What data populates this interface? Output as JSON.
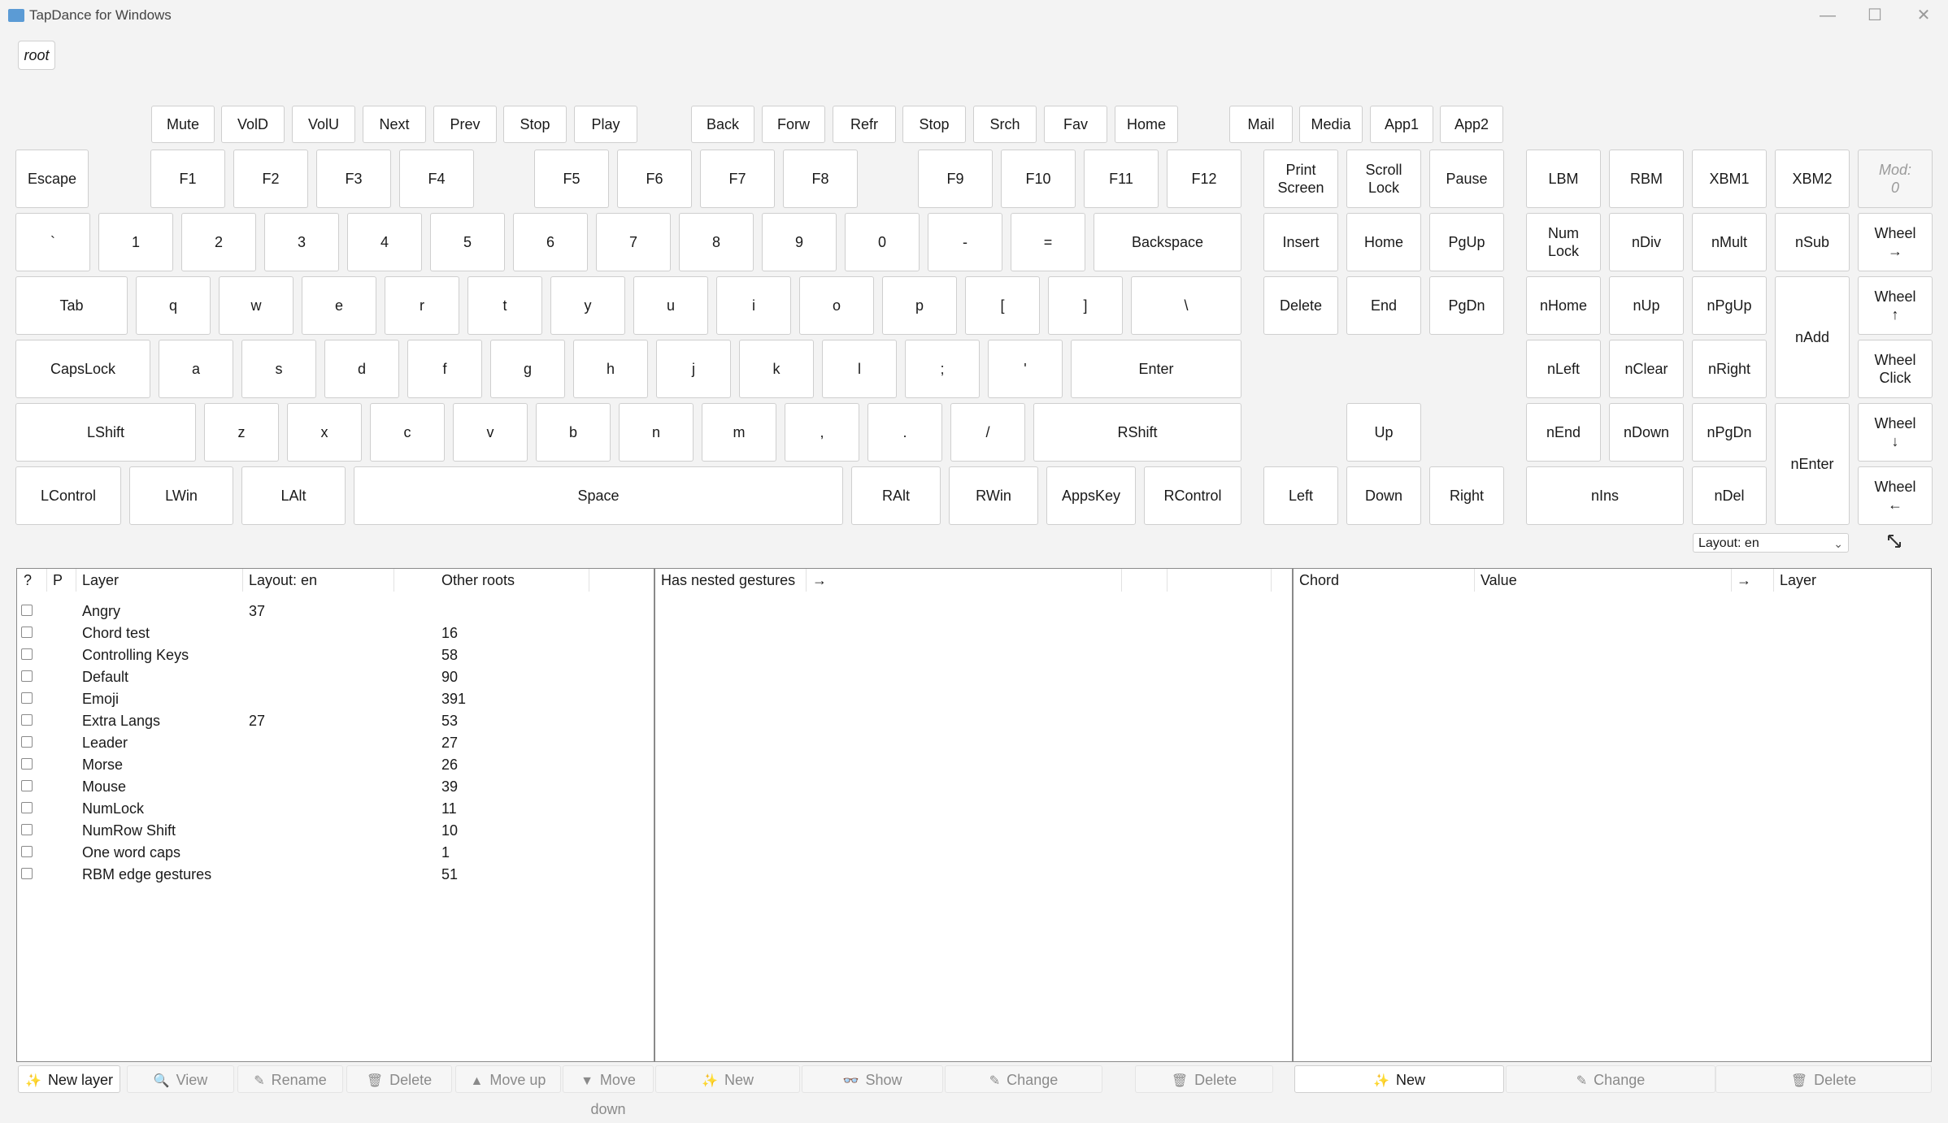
{
  "window": {
    "title": "TapDance for Windows",
    "minimize": "—",
    "maximize": "☐",
    "close": "✕"
  },
  "root_button": "root",
  "keys": [
    {
      "id": "mute",
      "label": "Mute"
    },
    {
      "id": "vold",
      "label": "VolD"
    },
    {
      "id": "volu",
      "label": "VolU"
    },
    {
      "id": "next",
      "label": "Next"
    },
    {
      "id": "prev",
      "label": "Prev"
    },
    {
      "id": "stop-media",
      "label": "Stop"
    },
    {
      "id": "play",
      "label": "Play"
    },
    {
      "id": "back",
      "label": "Back"
    },
    {
      "id": "forw",
      "label": "Forw"
    },
    {
      "id": "refr",
      "label": "Refr"
    },
    {
      "id": "stop-browser",
      "label": "Stop"
    },
    {
      "id": "srch",
      "label": "Srch"
    },
    {
      "id": "fav",
      "label": "Fav"
    },
    {
      "id": "home-browser",
      "label": "Home"
    },
    {
      "id": "mail",
      "label": "Mail"
    },
    {
      "id": "media",
      "label": "Media"
    },
    {
      "id": "app1",
      "label": "App1"
    },
    {
      "id": "app2",
      "label": "App2"
    },
    {
      "id": "escape",
      "label": "Escape"
    },
    {
      "id": "f1",
      "label": "F1"
    },
    {
      "id": "f2",
      "label": "F2"
    },
    {
      "id": "f3",
      "label": "F3"
    },
    {
      "id": "f4",
      "label": "F4"
    },
    {
      "id": "f5",
      "label": "F5"
    },
    {
      "id": "f6",
      "label": "F6"
    },
    {
      "id": "f7",
      "label": "F7"
    },
    {
      "id": "f8",
      "label": "F8"
    },
    {
      "id": "f9",
      "label": "F9"
    },
    {
      "id": "f10",
      "label": "F10"
    },
    {
      "id": "f11",
      "label": "F11"
    },
    {
      "id": "f12",
      "label": "F12"
    },
    {
      "id": "print-screen",
      "label": "Print\nScreen"
    },
    {
      "id": "scroll-lock",
      "label": "Scroll\nLock"
    },
    {
      "id": "pause",
      "label": "Pause"
    },
    {
      "id": "lbm",
      "label": "LBM"
    },
    {
      "id": "rbm",
      "label": "RBM"
    },
    {
      "id": "xbm1",
      "label": "XBM1"
    },
    {
      "id": "xbm2",
      "label": "XBM2"
    },
    {
      "id": "mod",
      "label": "Mod:\n0"
    },
    {
      "id": "backtick",
      "label": "`"
    },
    {
      "id": "1",
      "label": "1"
    },
    {
      "id": "2",
      "label": "2"
    },
    {
      "id": "3",
      "label": "3"
    },
    {
      "id": "4",
      "label": "4"
    },
    {
      "id": "5",
      "label": "5"
    },
    {
      "id": "6",
      "label": "6"
    },
    {
      "id": "7",
      "label": "7"
    },
    {
      "id": "8",
      "label": "8"
    },
    {
      "id": "9",
      "label": "9"
    },
    {
      "id": "0",
      "label": "0"
    },
    {
      "id": "minus",
      "label": "-"
    },
    {
      "id": "equals",
      "label": "="
    },
    {
      "id": "backspace",
      "label": "Backspace"
    },
    {
      "id": "insert",
      "label": "Insert"
    },
    {
      "id": "home",
      "label": "Home"
    },
    {
      "id": "pgup",
      "label": "PgUp"
    },
    {
      "id": "numlock",
      "label": "Num\nLock"
    },
    {
      "id": "ndiv",
      "label": "nDiv"
    },
    {
      "id": "nmult",
      "label": "nMult"
    },
    {
      "id": "nsub",
      "label": "nSub"
    },
    {
      "id": "wheel-right",
      "label": "Wheel\n→"
    },
    {
      "id": "tab",
      "label": "Tab"
    },
    {
      "id": "q",
      "label": "q"
    },
    {
      "id": "w",
      "label": "w"
    },
    {
      "id": "e",
      "label": "e"
    },
    {
      "id": "r",
      "label": "r"
    },
    {
      "id": "t",
      "label": "t"
    },
    {
      "id": "y",
      "label": "y"
    },
    {
      "id": "u",
      "label": "u"
    },
    {
      "id": "i",
      "label": "i"
    },
    {
      "id": "o",
      "label": "o"
    },
    {
      "id": "p",
      "label": "p"
    },
    {
      "id": "lbracket",
      "label": "["
    },
    {
      "id": "rbracket",
      "label": "]"
    },
    {
      "id": "backslash",
      "label": "\\"
    },
    {
      "id": "delete",
      "label": "Delete"
    },
    {
      "id": "end",
      "label": "End"
    },
    {
      "id": "pgdn",
      "label": "PgDn"
    },
    {
      "id": "nhome",
      "label": "nHome"
    },
    {
      "id": "nup",
      "label": "nUp"
    },
    {
      "id": "npgup",
      "label": "nPgUp"
    },
    {
      "id": "nadd",
      "label": "nAdd"
    },
    {
      "id": "wheel-up",
      "label": "Wheel\n↑"
    },
    {
      "id": "capslock",
      "label": "CapsLock"
    },
    {
      "id": "a",
      "label": "a"
    },
    {
      "id": "s",
      "label": "s"
    },
    {
      "id": "d",
      "label": "d"
    },
    {
      "id": "f",
      "label": "f"
    },
    {
      "id": "g",
      "label": "g"
    },
    {
      "id": "h",
      "label": "h"
    },
    {
      "id": "j",
      "label": "j"
    },
    {
      "id": "k",
      "label": "k"
    },
    {
      "id": "l",
      "label": "l"
    },
    {
      "id": "semicolon",
      "label": ";"
    },
    {
      "id": "quote",
      "label": "'"
    },
    {
      "id": "enter",
      "label": "Enter"
    },
    {
      "id": "nleft",
      "label": "nLeft"
    },
    {
      "id": "nclear",
      "label": "nClear"
    },
    {
      "id": "nright",
      "label": "nRight"
    },
    {
      "id": "wheel-click",
      "label": "Wheel\nClick"
    },
    {
      "id": "lshift",
      "label": "LShift"
    },
    {
      "id": "z",
      "label": "z"
    },
    {
      "id": "x",
      "label": "x"
    },
    {
      "id": "c",
      "label": "c"
    },
    {
      "id": "v",
      "label": "v"
    },
    {
      "id": "b",
      "label": "b"
    },
    {
      "id": "n",
      "label": "n"
    },
    {
      "id": "m",
      "label": "m"
    },
    {
      "id": "comma",
      "label": ","
    },
    {
      "id": "period",
      "label": "."
    },
    {
      "id": "slash",
      "label": "/"
    },
    {
      "id": "rshift",
      "label": "RShift"
    },
    {
      "id": "up",
      "label": "Up"
    },
    {
      "id": "nend",
      "label": "nEnd"
    },
    {
      "id": "ndown",
      "label": "nDown"
    },
    {
      "id": "npgdn",
      "label": "nPgDn"
    },
    {
      "id": "nenter",
      "label": "nEnter"
    },
    {
      "id": "wheel-down",
      "label": "Wheel\n↓"
    },
    {
      "id": "lcontrol",
      "label": "LControl"
    },
    {
      "id": "lwin",
      "label": "LWin"
    },
    {
      "id": "lalt",
      "label": "LAlt"
    },
    {
      "id": "space",
      "label": "Space"
    },
    {
      "id": "ralt",
      "label": "RAlt"
    },
    {
      "id": "rwin",
      "label": "RWin"
    },
    {
      "id": "appskey",
      "label": "AppsKey"
    },
    {
      "id": "rcontrol",
      "label": "RControl"
    },
    {
      "id": "left",
      "label": "Left"
    },
    {
      "id": "down",
      "label": "Down"
    },
    {
      "id": "right",
      "label": "Right"
    },
    {
      "id": "nins",
      "label": "nIns"
    },
    {
      "id": "ndel",
      "label": "nDel"
    },
    {
      "id": "wheel-left",
      "label": "Wheel\n←"
    }
  ],
  "layout_select": {
    "value": "Layout: en"
  },
  "layers_panel": {
    "columns": {
      "q": "?",
      "p": "P",
      "layer": "Layer",
      "layout": "Layout: en",
      "other": "Other roots"
    },
    "rows": [
      {
        "name": "Angry",
        "layout": "37",
        "other": ""
      },
      {
        "name": "Chord test",
        "layout": "",
        "other": "16"
      },
      {
        "name": "Controlling Keys",
        "layout": "",
        "other": "58"
      },
      {
        "name": "Default",
        "layout": "",
        "other": "90"
      },
      {
        "name": "Emoji",
        "layout": "",
        "other": "391"
      },
      {
        "name": "Extra Langs",
        "layout": "27",
        "other": "53"
      },
      {
        "name": "Leader",
        "layout": "",
        "other": "27"
      },
      {
        "name": "Morse",
        "layout": "",
        "other": "26"
      },
      {
        "name": "Mouse",
        "layout": "",
        "other": "39"
      },
      {
        "name": "NumLock",
        "layout": "",
        "other": "11"
      },
      {
        "name": "NumRow Shift",
        "layout": "",
        "other": "10"
      },
      {
        "name": "One word caps",
        "layout": "",
        "other": "1"
      },
      {
        "name": "RBM edge gestures",
        "layout": "",
        "other": "51"
      }
    ]
  },
  "gestures_panel": {
    "columns": {
      "nested": "Has nested gestures",
      "arrow": "→"
    }
  },
  "chords_panel": {
    "columns": {
      "chord": "Chord",
      "value": "Value",
      "arrow": "→",
      "layer": "Layer"
    }
  },
  "toolbar": [
    {
      "id": "new-layer",
      "label": "New layer",
      "icon": "✨",
      "active": true
    },
    {
      "id": "view",
      "label": "View",
      "icon": "🔍",
      "active": false
    },
    {
      "id": "rename",
      "label": "Rename",
      "icon": "✎",
      "active": false
    },
    {
      "id": "delete-layer",
      "label": "Delete",
      "icon": "🗑",
      "active": false
    },
    {
      "id": "move-up",
      "label": "Move up",
      "icon": "▲",
      "active": false
    },
    {
      "id": "move-down",
      "label": "Move down",
      "icon": "▼",
      "active": false
    },
    {
      "id": "new-gesture",
      "label": "New",
      "icon": "✨",
      "active": false
    },
    {
      "id": "show",
      "label": "Show",
      "icon": "👓",
      "active": false
    },
    {
      "id": "change-gesture",
      "label": "Change",
      "icon": "✎",
      "active": false
    },
    {
      "id": "delete-gesture",
      "label": "Delete",
      "icon": "🗑",
      "active": false
    },
    {
      "id": "new-chord",
      "label": "New",
      "icon": "✨",
      "active": true
    },
    {
      "id": "change-chord",
      "label": "Change",
      "icon": "✎",
      "active": false
    },
    {
      "id": "delete-chord",
      "label": "Delete",
      "icon": "🗑",
      "active": false
    }
  ]
}
